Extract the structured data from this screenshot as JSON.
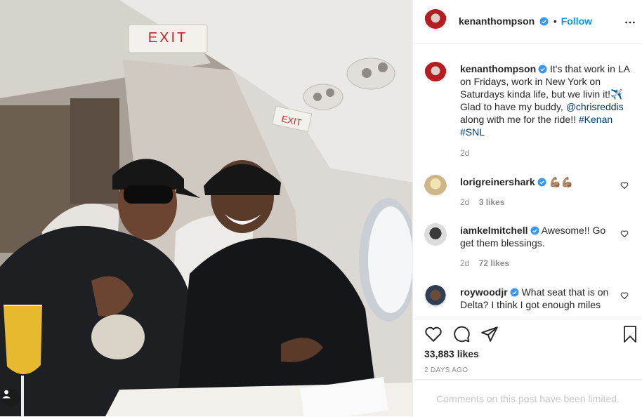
{
  "photo": {
    "exit_sign_top": "EXIT",
    "exit_sign_side": "EXIT"
  },
  "header": {
    "username": "kenanthompson",
    "separator": "•",
    "follow_label": "Follow",
    "more_icon": "more-horizontal-icon"
  },
  "caption": {
    "username": "kenanthompson",
    "text_1": "It's that work in LA on Fridays, work in New York on Saturdays kinda life, but we livin it!",
    "emoji": "✈️",
    "text_2": "Glad to have my buddy,",
    "mention": "@chrisreddis",
    "text_3": "along with me for the ride!!",
    "hashtag_1": "#Kenan",
    "hashtag_2": "#SNL",
    "age": "2d"
  },
  "comments": [
    {
      "username": "lorigreinershark",
      "text": "💪🏽💪🏽",
      "age": "2d",
      "likes": "3 likes"
    },
    {
      "username": "iamkelmitchell",
      "text": "Awesome!! Go get them blessings.",
      "age": "2d",
      "likes": "72 likes"
    },
    {
      "username": "roywoodjr",
      "text": "What seat that is on Delta? I think I got enough miles",
      "age": "",
      "likes": ""
    }
  ],
  "actions": {
    "like_icon": "heart-icon",
    "comment_icon": "comment-icon",
    "share_icon": "paper-plane-icon",
    "save_icon": "bookmark-icon",
    "likes_count": "33,883 likes",
    "timestamp": "2 DAYS AGO"
  },
  "footer": {
    "limited_text": "Comments on this post have been limited."
  },
  "colors": {
    "link_blue": "#0095f6",
    "mention_blue": "#00376b",
    "verified_blue": "#3897f0"
  }
}
